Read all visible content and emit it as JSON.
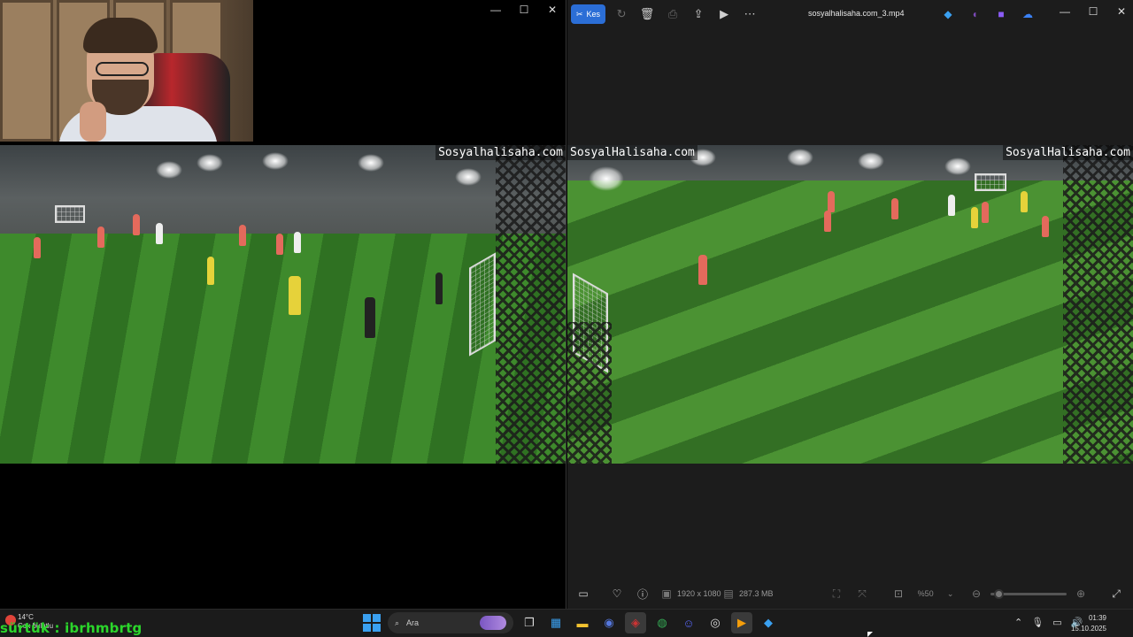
{
  "left_window": {
    "watermark": "Sosyalhalisaha.com",
    "controls": {
      "minimize": "—",
      "maximize": "☐",
      "close": "✕"
    }
  },
  "photos": {
    "toolbar": {
      "trim_label": "Kes",
      "icons": [
        "rotate-icon",
        "delete-icon",
        "print-icon",
        "share-icon",
        "video-icon",
        "more-icon"
      ],
      "more_label": "⋯"
    },
    "file_title": "sosyalhalisaha.com_3.mp4",
    "video_watermarks": [
      "SosyalHalisaha.com",
      "SosyalHalisaha.com"
    ],
    "controls": {
      "minimize": "—",
      "maximize": "☐",
      "close": "✕"
    },
    "bottom": {
      "resolution": "1920 x 1080",
      "file_size": "287.3 MB",
      "zoom": "%50",
      "zoom_level": 0.1
    }
  },
  "taskbar": {
    "weather_temp": "14°C",
    "weather_desc": "Çok bulutlu",
    "search_placeholder": "Ara",
    "clock_time": "01:39",
    "clock_date": "15.10.2025"
  },
  "overlay_text": "sürtük : ibrhmbrtg",
  "colors": {
    "accent": "#2b6ed6",
    "overlay_green": "#2bd62b"
  }
}
